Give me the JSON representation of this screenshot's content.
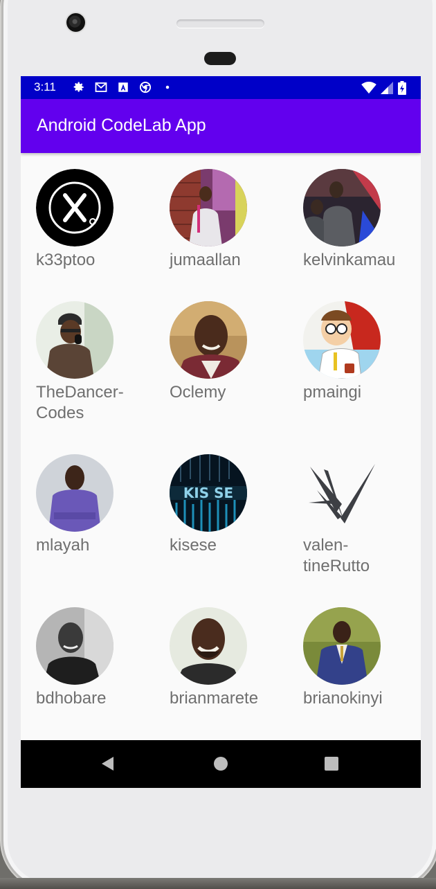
{
  "status_bar": {
    "time": "3:11",
    "icons": [
      "gear-icon",
      "gmail-icon",
      "a-icon",
      "chrome-icon",
      "dot-icon"
    ],
    "right_icons": [
      "wifi-icon",
      "signal-icon",
      "battery-icon"
    ],
    "color": "#0000c8"
  },
  "app_bar": {
    "title": "Android CodeLab App",
    "color": "#6200ee"
  },
  "users": [
    {
      "name": "k33ptoo",
      "avatar": "logo-x-icon"
    },
    {
      "name": "jumaallan",
      "avatar": "speaker-photo"
    },
    {
      "name": "kelvinkamau",
      "avatar": "crowd-photo"
    },
    {
      "name": "TheDancer-\nCodes",
      "avatar": "mic-photo"
    },
    {
      "name": "Oclemy",
      "avatar": "smiling-man-photo"
    },
    {
      "name": "pmaingi",
      "avatar": "cartoon-coder-photo"
    },
    {
      "name": "mlayah",
      "avatar": "purple-shirt-photo"
    },
    {
      "name": "kisese",
      "avatar": "matrix-photo"
    },
    {
      "name": "valen-\ntineRutto",
      "avatar": "vr-logo-icon"
    },
    {
      "name": "bdhobare",
      "avatar": "bw-portrait-photo"
    },
    {
      "name": "brianmarete",
      "avatar": "bald-man-photo"
    },
    {
      "name": "brianokinyi",
      "avatar": "suit-man-photo"
    }
  ],
  "nav_bar": {
    "buttons": [
      "back-icon",
      "home-icon",
      "recents-icon"
    ]
  }
}
